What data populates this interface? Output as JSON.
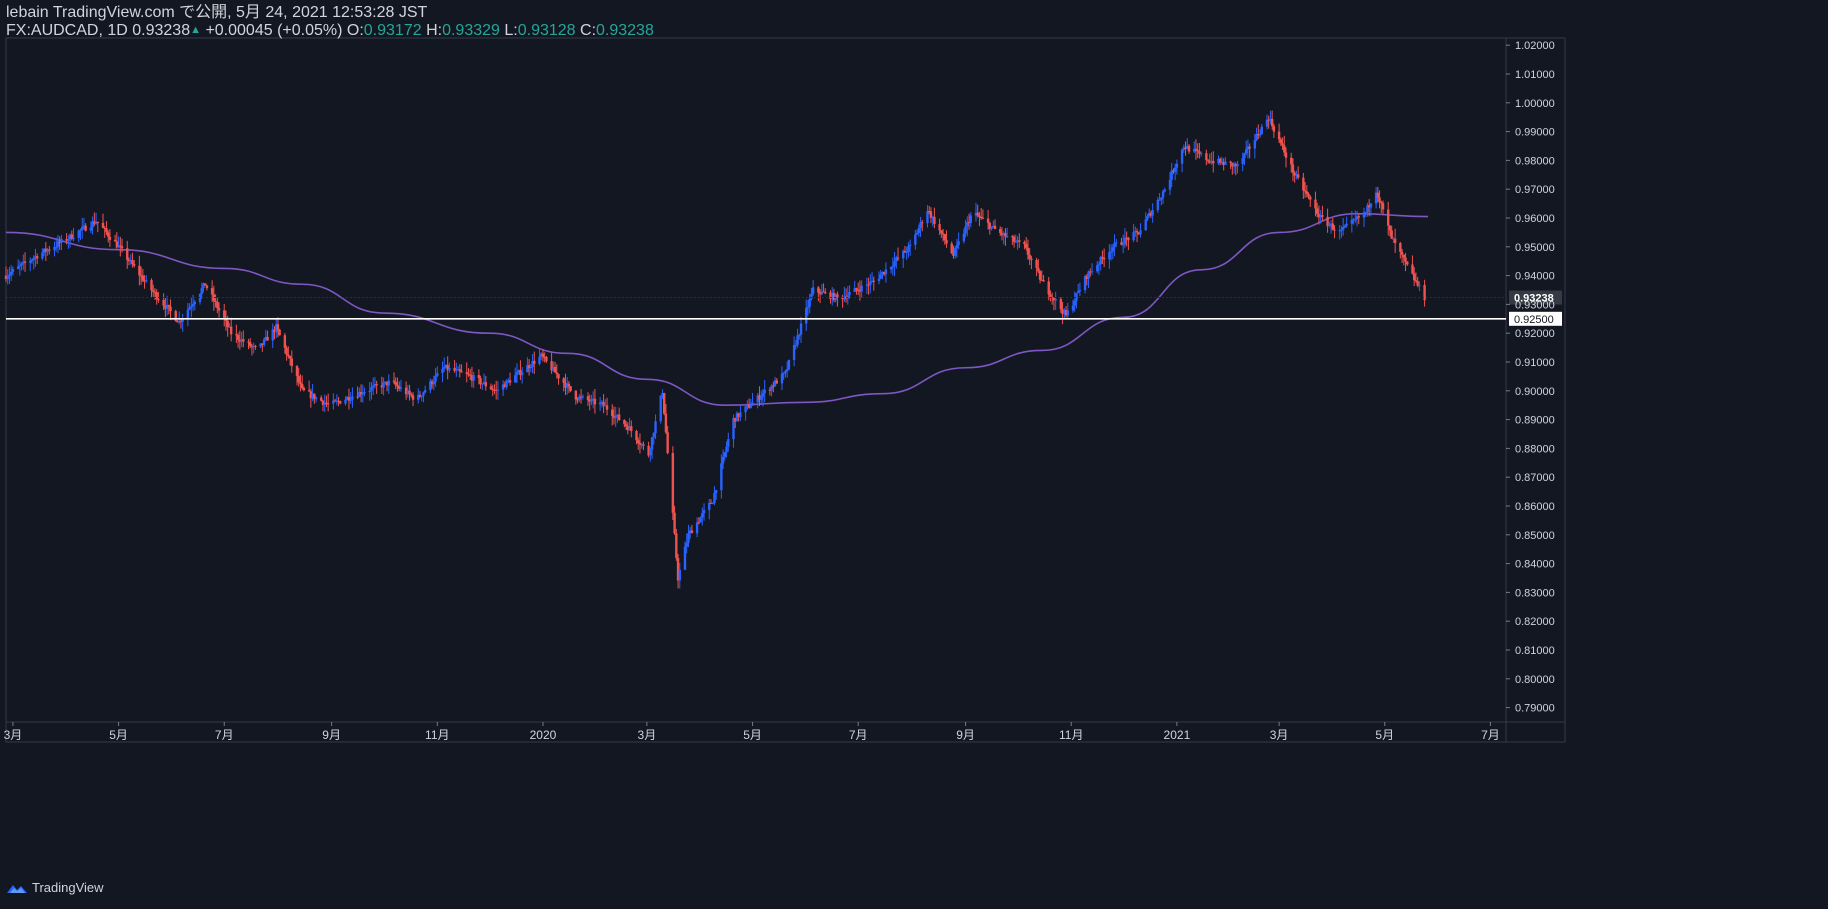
{
  "header": {
    "publish_line": "lebain TradingView.com で公開, 5月 24, 2021 12:53:28 JST",
    "symbol": "FX:AUDCAD, 1D",
    "last": "0.93238",
    "change": "+0.00045 (+0.05%)",
    "o_label": "O:",
    "o_value": "0.93172",
    "h_label": "H:",
    "h_value": "0.93329",
    "l_label": "L:",
    "l_value": "0.93128",
    "c_label": "C:",
    "c_value": "0.93238"
  },
  "footer": {
    "brand": "TradingView"
  },
  "colors": {
    "background": "#131722",
    "up": "#2962ff",
    "down": "#ef5350",
    "ma": "#7e57c2",
    "level_line": "#ffffff",
    "grid": "#1e222d",
    "text": "#d1d4dc",
    "header_value": "#26a69a"
  },
  "chart_data": {
    "type": "candlestick",
    "title": "FX:AUDCAD, 1D",
    "ylim": [
      0.785,
      1.0225
    ],
    "yticks": [
      1.02,
      1.01,
      1.0,
      0.99,
      0.98,
      0.97,
      0.96,
      0.95,
      0.94,
      0.93,
      0.92,
      0.91,
      0.9,
      0.89,
      0.88,
      0.87,
      0.86,
      0.85,
      0.84,
      0.83,
      0.82,
      0.81,
      0.8,
      0.79
    ],
    "ytick_labels": [
      "1.02000",
      "1.01000",
      "1.00000",
      "0.99000",
      "0.98000",
      "0.97000",
      "0.96000",
      "0.95000",
      "0.94000",
      "0.93000",
      "0.92000",
      "0.91000",
      "0.90000",
      "0.89000",
      "0.88000",
      "0.87000",
      "0.86000",
      "0.85000",
      "0.84000",
      "0.83000",
      "0.82000",
      "0.81000",
      "0.80000",
      "0.79000"
    ],
    "x_period": [
      "2019-02-25",
      "2021-07-10"
    ],
    "xtick_dates": [
      "2019-03-01",
      "2019-05-01",
      "2019-07-01",
      "2019-09-01",
      "2019-11-01",
      "2020-01-01",
      "2020-03-01",
      "2020-05-01",
      "2020-07-01",
      "2020-09-01",
      "2020-11-01",
      "2021-01-01",
      "2021-03-01",
      "2021-05-01",
      "2021-07-01"
    ],
    "xtick_labels": [
      "3月",
      "5月",
      "7月",
      "9月",
      "11月",
      "2020",
      "3月",
      "5月",
      "7月",
      "9月",
      "11月",
      "2021",
      "3月",
      "5月",
      "7月"
    ],
    "price_path": [
      [
        "2019-02-25",
        0.94
      ],
      [
        "2019-03-15",
        0.947
      ],
      [
        "2019-04-02",
        0.953
      ],
      [
        "2019-04-18",
        0.959
      ],
      [
        "2019-05-01",
        0.95
      ],
      [
        "2019-05-20",
        0.935
      ],
      [
        "2019-06-05",
        0.924
      ],
      [
        "2019-06-20",
        0.937
      ],
      [
        "2019-07-05",
        0.92
      ],
      [
        "2019-07-20",
        0.914
      ],
      [
        "2019-07-31",
        0.922
      ],
      [
        "2019-08-15",
        0.9
      ],
      [
        "2019-08-31",
        0.895
      ],
      [
        "2019-09-20",
        0.9
      ],
      [
        "2019-10-05",
        0.903
      ],
      [
        "2019-10-20",
        0.897
      ],
      [
        "2019-11-05",
        0.908
      ],
      [
        "2019-11-20",
        0.905
      ],
      [
        "2019-12-05",
        0.9
      ],
      [
        "2019-12-20",
        0.907
      ],
      [
        "2019-12-31",
        0.912
      ],
      [
        "2020-01-20",
        0.898
      ],
      [
        "2020-02-05",
        0.895
      ],
      [
        "2020-02-20",
        0.887
      ],
      [
        "2020-03-02",
        0.878
      ],
      [
        "2020-03-10",
        0.9
      ],
      [
        "2020-03-19",
        0.835
      ],
      [
        "2020-03-25",
        0.85
      ],
      [
        "2020-04-08",
        0.862
      ],
      [
        "2020-04-20",
        0.89
      ],
      [
        "2020-05-05",
        0.898
      ],
      [
        "2020-05-20",
        0.906
      ],
      [
        "2020-06-05",
        0.935
      ],
      [
        "2020-06-20",
        0.932
      ],
      [
        "2020-07-10",
        0.938
      ],
      [
        "2020-07-31",
        0.95
      ],
      [
        "2020-08-10",
        0.963
      ],
      [
        "2020-08-25",
        0.947
      ],
      [
        "2020-09-05",
        0.962
      ],
      [
        "2020-09-20",
        0.955
      ],
      [
        "2020-10-05",
        0.95
      ],
      [
        "2020-10-15",
        0.938
      ],
      [
        "2020-10-29",
        0.926
      ],
      [
        "2020-11-10",
        0.94
      ],
      [
        "2020-11-25",
        0.95
      ],
      [
        "2020-12-10",
        0.955
      ],
      [
        "2020-12-25",
        0.97
      ],
      [
        "2021-01-05",
        0.985
      ],
      [
        "2021-01-20",
        0.98
      ],
      [
        "2021-02-05",
        0.978
      ],
      [
        "2021-02-23",
        0.995
      ],
      [
        "2021-03-10",
        0.975
      ],
      [
        "2021-03-25",
        0.96
      ],
      [
        "2021-04-05",
        0.955
      ],
      [
        "2021-04-20",
        0.962
      ],
      [
        "2021-04-26",
        0.97
      ],
      [
        "2021-05-05",
        0.953
      ],
      [
        "2021-05-15",
        0.942
      ],
      [
        "2021-05-24",
        0.9324
      ]
    ],
    "ma_series": {
      "name": "MA",
      "points": [
        [
          "2019-02-25",
          0.955
        ],
        [
          "2019-05-01",
          0.949
        ],
        [
          "2019-07-01",
          0.9425
        ],
        [
          "2019-08-15",
          0.937
        ],
        [
          "2019-10-01",
          0.927
        ],
        [
          "2019-12-01",
          0.92
        ],
        [
          "2020-01-15",
          0.913
        ],
        [
          "2020-03-01",
          0.904
        ],
        [
          "2020-04-15",
          0.895
        ],
        [
          "2020-06-01",
          0.896
        ],
        [
          "2020-07-15",
          0.899
        ],
        [
          "2020-09-01",
          0.908
        ],
        [
          "2020-10-15",
          0.914
        ],
        [
          "2020-12-01",
          0.9255
        ],
        [
          "2021-01-15",
          0.942
        ],
        [
          "2021-03-01",
          0.955
        ],
        [
          "2021-04-15",
          0.9615
        ],
        [
          "2021-05-26",
          0.9605
        ]
      ]
    },
    "horizontal_level": {
      "value": 0.925,
      "label": "0.92500"
    },
    "last_price": {
      "value": 0.93238,
      "label": "0.93238"
    },
    "grid": false
  }
}
